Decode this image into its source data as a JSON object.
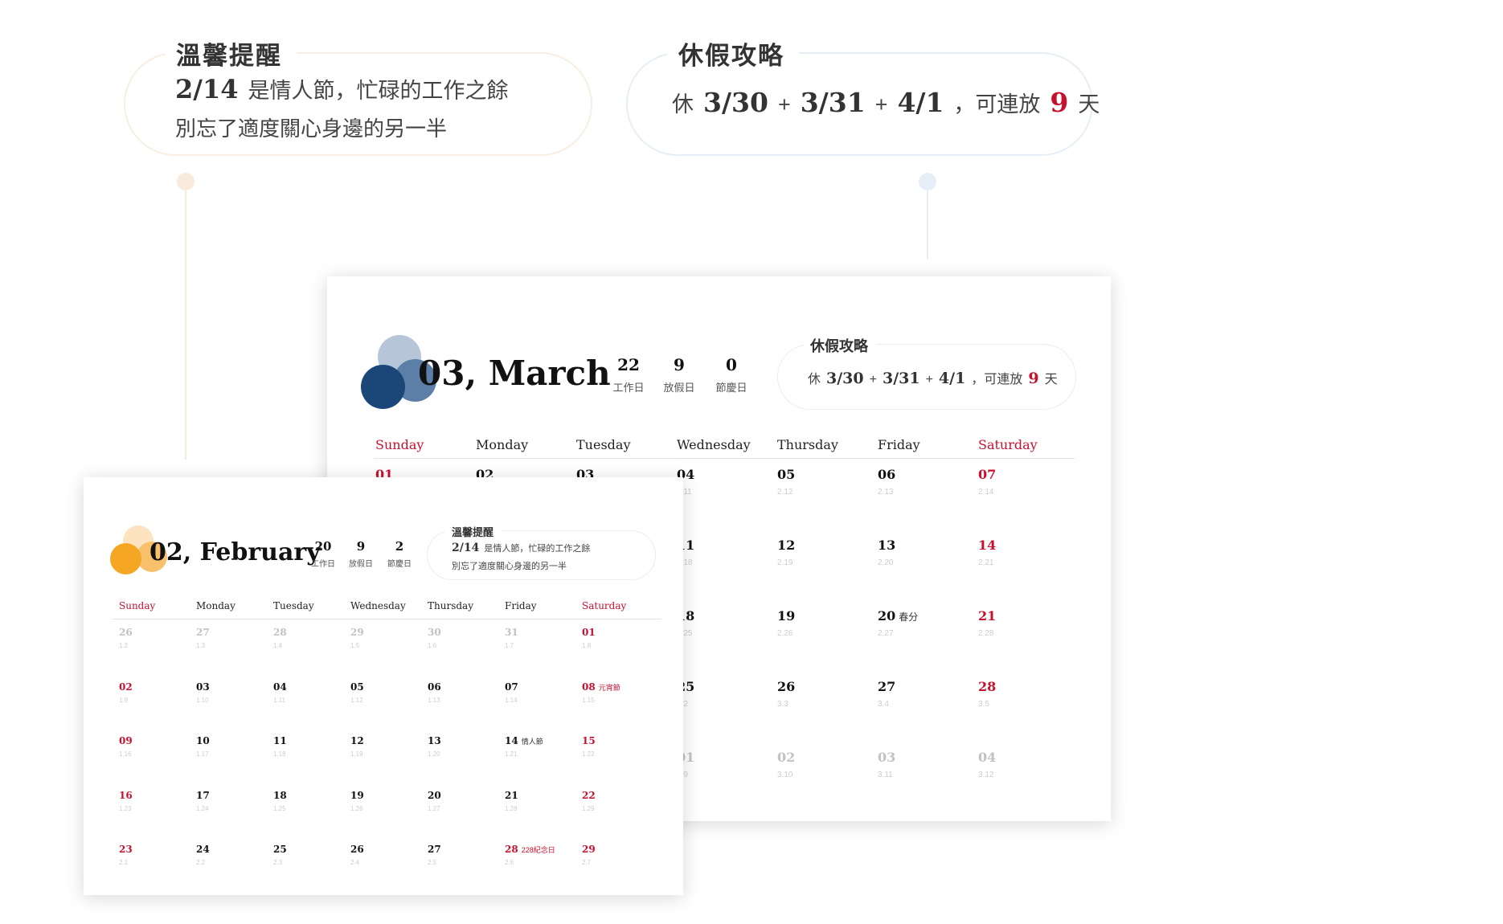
{
  "reminder": {
    "title": "溫馨提醒",
    "date": "2/14",
    "line1": "是情人節，忙碌的工作之餘",
    "line2": "別忘了適度關心身邊的另一半"
  },
  "vacation": {
    "title": "休假攻略",
    "prefix": "休",
    "d1": "3/30",
    "plus1": "+",
    "d2": "3/31",
    "plus2": "+",
    "d3": "4/1",
    "mid": "，可連放",
    "count": "9",
    "unit": "天"
  },
  "colors": {
    "accent_red": "#c8102e",
    "march_dark": "#1a4778",
    "march_mid": "#5b7fa6",
    "march_light": "#b6c6d8",
    "feb_dark": "#f5a623",
    "feb_mid": "#f9c06c",
    "feb_light": "#fde3bf"
  },
  "march": {
    "title": "03, March",
    "stats": [
      {
        "num": "22",
        "label": "工作日"
      },
      {
        "num": "9",
        "label": "放假日"
      },
      {
        "num": "0",
        "label": "節慶日"
      }
    ],
    "tip": {
      "title": "休假攻略",
      "prefix": "休",
      "d1": "3/30",
      "plus1": "+",
      "d2": "3/31",
      "plus2": "+",
      "d3": "4/1",
      "mid": "，可連放",
      "count": "9",
      "unit": "天"
    },
    "weekdays": [
      "Sunday",
      "Monday",
      "Tuesday",
      "Wednesday",
      "Thursday",
      "Friday",
      "Saturday"
    ],
    "rows": [
      [
        {
          "d": "01"
        },
        {
          "d": "02"
        },
        {
          "d": "03"
        },
        {
          "d": "04",
          "l": "2.11"
        },
        {
          "d": "05",
          "l": "2.12"
        },
        {
          "d": "06",
          "l": "2.13"
        },
        {
          "d": "07",
          "l": "2.14"
        }
      ],
      [
        {
          "d": ""
        },
        {
          "d": ""
        },
        {
          "d": ""
        },
        {
          "d": "11",
          "l": "2.18"
        },
        {
          "d": "12",
          "l": "2.19"
        },
        {
          "d": "13",
          "l": "2.20"
        },
        {
          "d": "14",
          "l": "2.21"
        }
      ],
      [
        {
          "d": ""
        },
        {
          "d": ""
        },
        {
          "d": ""
        },
        {
          "d": "18",
          "l": "2.25"
        },
        {
          "d": "19",
          "l": "2.26"
        },
        {
          "d": "20",
          "n": "春分",
          "l": "2.27"
        },
        {
          "d": "21",
          "l": "2.28"
        }
      ],
      [
        {
          "d": ""
        },
        {
          "d": ""
        },
        {
          "d": ""
        },
        {
          "d": "25",
          "l": "3.2"
        },
        {
          "d": "26",
          "l": "3.3"
        },
        {
          "d": "27",
          "l": "3.4"
        },
        {
          "d": "28",
          "l": "3.5"
        }
      ],
      [
        {
          "d": ""
        },
        {
          "d": ""
        },
        {
          "d": ""
        },
        {
          "d": "01",
          "l": "3.9"
        },
        {
          "d": "02",
          "l": "3.10"
        },
        {
          "d": "03",
          "l": "3.11"
        },
        {
          "d": "04",
          "l": "3.12"
        }
      ]
    ]
  },
  "february": {
    "title": "02, February",
    "stats": [
      {
        "num": "20",
        "label": "工作日"
      },
      {
        "num": "9",
        "label": "放假日"
      },
      {
        "num": "2",
        "label": "節慶日"
      }
    ],
    "tip": {
      "title": "溫馨提醒",
      "date": "2/14",
      "line1": "是情人節，忙碌的工作之餘",
      "line2": "別忘了適度關心身邊的另一半"
    },
    "weekdays": [
      "Sunday",
      "Monday",
      "Tuesday",
      "Wednesday",
      "Thursday",
      "Friday",
      "Saturday"
    ],
    "rows": [
      [
        {
          "d": "26",
          "l": "1.2"
        },
        {
          "d": "27",
          "l": "1.3"
        },
        {
          "d": "28",
          "l": "1.4"
        },
        {
          "d": "29",
          "l": "1.5"
        },
        {
          "d": "30",
          "l": "1.6"
        },
        {
          "d": "31",
          "l": "1.7"
        },
        {
          "d": "01",
          "l": "1.8"
        }
      ],
      [
        {
          "d": "02",
          "l": "1.9"
        },
        {
          "d": "03",
          "l": "1.10"
        },
        {
          "d": "04",
          "l": "1.11"
        },
        {
          "d": "05",
          "l": "1.12"
        },
        {
          "d": "06",
          "l": "1.13"
        },
        {
          "d": "07",
          "l": "1.14"
        },
        {
          "d": "08",
          "n": "元宵節",
          "l": "1.15"
        }
      ],
      [
        {
          "d": "09",
          "l": "1.16"
        },
        {
          "d": "10",
          "l": "1.17"
        },
        {
          "d": "11",
          "l": "1.18"
        },
        {
          "d": "12",
          "l": "1.19"
        },
        {
          "d": "13",
          "l": "1.20"
        },
        {
          "d": "14",
          "n": "情人節",
          "l": "1.21"
        },
        {
          "d": "15",
          "l": "1.22"
        }
      ],
      [
        {
          "d": "16",
          "l": "1.23"
        },
        {
          "d": "17",
          "l": "1.24"
        },
        {
          "d": "18",
          "l": "1.25"
        },
        {
          "d": "19",
          "l": "1.26"
        },
        {
          "d": "20",
          "l": "1.27"
        },
        {
          "d": "21",
          "l": "1.28"
        },
        {
          "d": "22",
          "l": "1.29"
        }
      ],
      [
        {
          "d": "23",
          "l": "2.1"
        },
        {
          "d": "24",
          "l": "2.2"
        },
        {
          "d": "25",
          "l": "2.3"
        },
        {
          "d": "26",
          "l": "2.4"
        },
        {
          "d": "27",
          "l": "2.5"
        },
        {
          "d": "28",
          "n": "228紀念日",
          "l": "2.6"
        },
        {
          "d": "29",
          "l": "2.7"
        }
      ]
    ]
  }
}
